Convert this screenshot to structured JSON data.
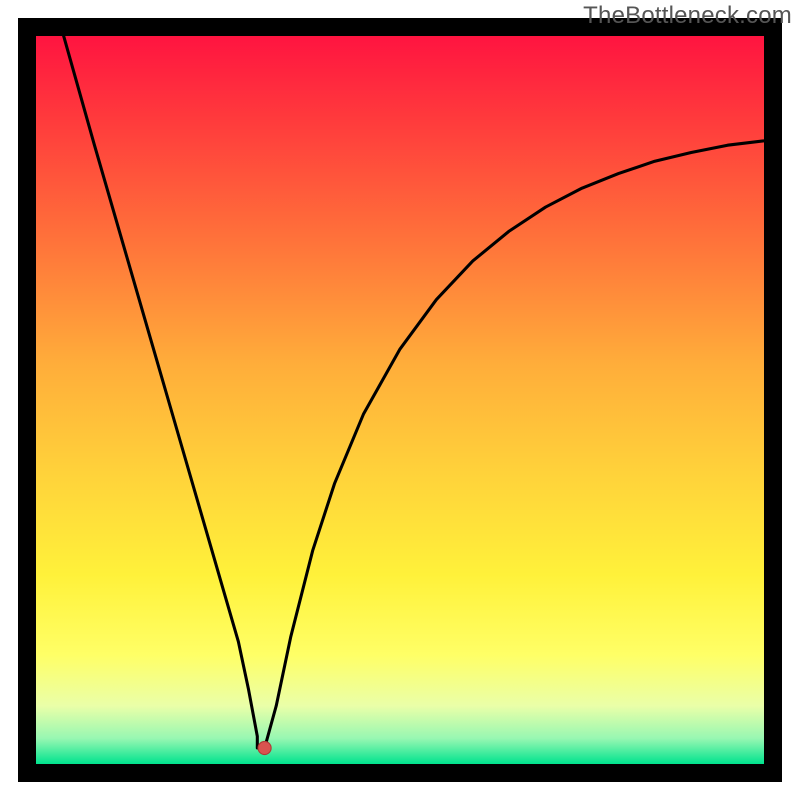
{
  "watermark": "TheBottleneck.com",
  "chart_data": {
    "type": "line",
    "title": "",
    "xlabel": "",
    "ylabel": "",
    "xlim": [
      0,
      100
    ],
    "ylim": [
      0,
      100
    ],
    "grid": false,
    "legend": false,
    "note": "No axes, ticks, or labels are visible in the image. Data values are estimated from pixel positions on a 0–100 normalized range (left→right for x, bottom→top for y). The curve consists of a near-linear descending left segment, a small flat minimum, and a concave ascending right segment. Dot marks the minimum.",
    "dot": {
      "x": 31.4,
      "y": 2.2,
      "color": "#d9534f"
    },
    "background_gradient_stops": [
      {
        "pos": 0.0,
        "color": "#ff1440"
      },
      {
        "pos": 0.12,
        "color": "#ff3c3c"
      },
      {
        "pos": 0.28,
        "color": "#ff723a"
      },
      {
        "pos": 0.45,
        "color": "#ffad3a"
      },
      {
        "pos": 0.6,
        "color": "#ffd23a"
      },
      {
        "pos": 0.74,
        "color": "#fff13a"
      },
      {
        "pos": 0.85,
        "color": "#ffff66"
      },
      {
        "pos": 0.92,
        "color": "#eaffa8"
      },
      {
        "pos": 0.965,
        "color": "#97f7b2"
      },
      {
        "pos": 1.0,
        "color": "#00e38e"
      }
    ],
    "series": [
      {
        "name": "left-descending",
        "x": [
          3.8,
          6,
          8,
          10,
          12,
          14,
          16,
          18,
          20,
          22,
          24,
          26,
          27.8,
          29.2,
          30.4
        ],
        "y": [
          100,
          92.2,
          85.1,
          78.2,
          71.3,
          64.4,
          57.5,
          50.6,
          43.7,
          36.8,
          29.9,
          23.0,
          16.8,
          10.2,
          3.8
        ]
      },
      {
        "name": "minimum-flat",
        "x": [
          30.4,
          31.4
        ],
        "y": [
          2.2,
          2.2
        ]
      },
      {
        "name": "right-ascending",
        "x": [
          31.4,
          33,
          35,
          38,
          41,
          45,
          50,
          55,
          60,
          65,
          70,
          75,
          80,
          85,
          90,
          95,
          100
        ],
        "y": [
          2.2,
          8.0,
          17.5,
          29.3,
          38.5,
          48.1,
          57.0,
          63.8,
          69.1,
          73.2,
          76.5,
          79.1,
          81.1,
          82.8,
          84.0,
          85.0,
          85.6
        ]
      }
    ]
  }
}
